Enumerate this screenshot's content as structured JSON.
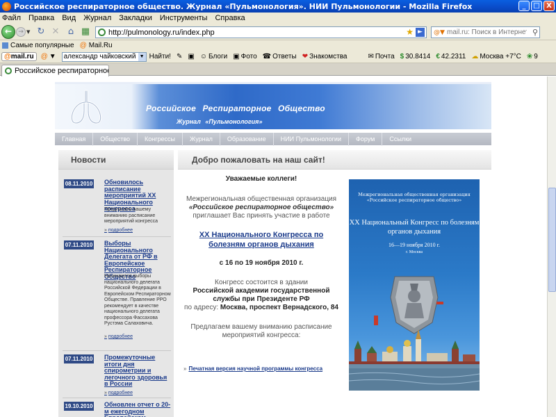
{
  "window": {
    "title": "Российское респираторное общество. Журнал «Пульмонология». НИИ Пульмонологии - Mozilla Firefox",
    "minimize": "_",
    "maximize": "□",
    "close": "X"
  },
  "menu": [
    "Файл",
    "Правка",
    "Вид",
    "Журнал",
    "Закладки",
    "Инструменты",
    "Справка"
  ],
  "address": {
    "url": "http://pulmonology.ru/index.php"
  },
  "search": {
    "placeholder": "mail.ru: Поиск в Интернете"
  },
  "bookmarks": [
    "Самые популярные",
    "Mail.Ru"
  ],
  "mailru_toolbar": {
    "logo": "mail.ru",
    "user": "александр чайковский",
    "find": "Найти!",
    "items": [
      "Блоги",
      "Фото",
      "Ответы",
      "Знакомства"
    ],
    "mail": "Почта",
    "usd": "30.8414",
    "eur": "42.2311",
    "weather": "Москва +7°C",
    "count": "9"
  },
  "tab": {
    "title": "Российское респираторное ..."
  },
  "site": {
    "title_line1": "Российское Респираторное Общество",
    "title_line2": "Журнал «Пульмонология»",
    "nav": [
      "Главная",
      "Общество",
      "Конгрессы",
      "Журнал",
      "Образование",
      "НИИ Пульмонологии",
      "Форум",
      "Ссылки"
    ],
    "news_heading": "Новости",
    "welcome_heading": "Добро пожаловать на наш сайт!",
    "news": [
      {
        "date": "08.11.2010",
        "title": "Обновилось расписание мероприятий XX Национального конгресса",
        "desc": "Предлагаем вашему вниманию расписание мероприятий конгресса",
        "more": "подробнее"
      },
      {
        "date": "07.11.2010",
        "title": "Выборы Национального Делегата от РФ в Европейское Респираторное Общество",
        "desc": "Начинаются выборы национального делегата Российской Федерации в Европейском Респираторном Обществе. Правление РРО рекомендует в качестве национального делегата профессора Фассахова Рустэма Салаховича.",
        "more": "подробнее"
      },
      {
        "date": "07.11.2010",
        "title": "Промежуточные итоги дня спирометрии и легочного здоровья в России",
        "desc": "",
        "more": "подробнее"
      },
      {
        "date": "19.10.2010",
        "title": "Обновлен отчет о 20-м ежегодном Европейском",
        "desc": "",
        "more": ""
      }
    ],
    "letter": {
      "greeting": "Уважаемые коллеги!",
      "intro": "Межрегиональная общественная организация",
      "org": "«Российское респираторное общество»",
      "invite": "приглашает Вас принять участие в работе",
      "congress_link": "XX Национального Конгресса по болезням органов дыхания",
      "dates": "с 16 по 19 ноября 2010 г.",
      "venue_intro": "Конгресс состоится в здании",
      "venue_name": "Российской академии государственной службы при Президенте РФ",
      "address_prefix": "по адресу:",
      "address": "Москва, проспект Вернадского, 84",
      "program_intro": "Предлагаем вашему вниманию расписание мероприятий конгресса:",
      "print_link": "Печатная версия научной программы конгресса"
    },
    "poster": {
      "org": "Межрегиональная общественная организация «Российское респираторное общество»",
      "title": "XX Национальный Конгресс по болезням органов дыхания",
      "dates": "16—19 ноября 2010 г.",
      "city": "г. Москва"
    }
  },
  "colors": {
    "accent": "#2f6ac8",
    "news_date_bg": "#2f4a86",
    "link": "#1a3a8a"
  }
}
